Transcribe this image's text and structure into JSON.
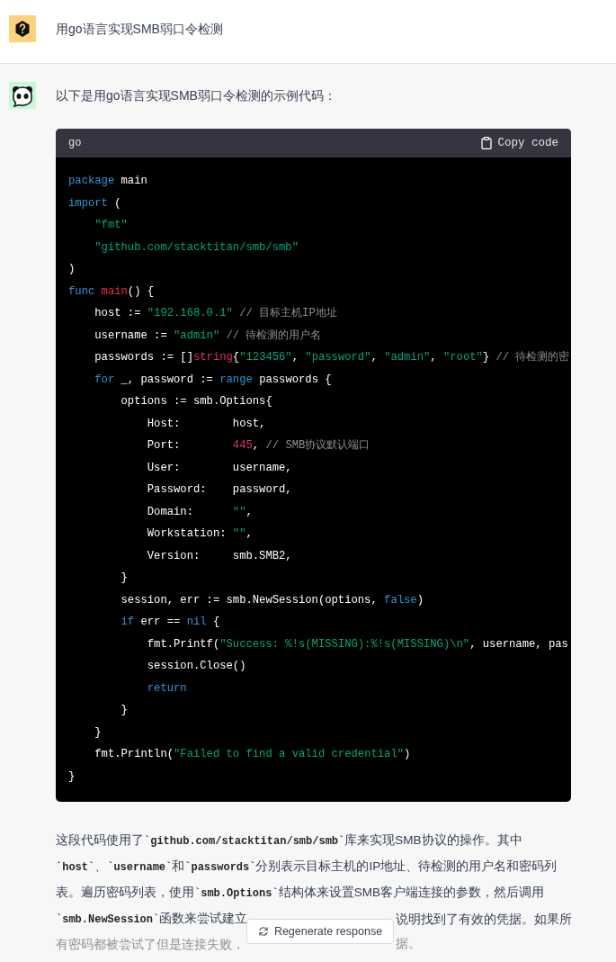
{
  "question": {
    "text": "用go语言实现SMB弱口令检测"
  },
  "answer": {
    "intro": "以下是用go语言实现SMB弱口令检测的示例代码：",
    "code_block": {
      "language": "go",
      "copy_label": "Copy code",
      "lines": [
        [
          {
            "kind": "kw",
            "text": "package"
          },
          {
            "kind": "plain",
            "text": " main"
          }
        ],
        [
          {
            "kind": "kw",
            "text": "import"
          },
          {
            "kind": "plain",
            "text": " ("
          }
        ],
        [
          {
            "kind": "str",
            "text": "    \"fmt\""
          }
        ],
        [
          {
            "kind": "str",
            "text": "    \"github.com/stacktitan/smb/smb\""
          }
        ],
        [
          {
            "kind": "plain",
            "text": ")"
          }
        ],
        [
          {
            "kind": "kw",
            "text": "func"
          },
          {
            "kind": "fn",
            "text": " main"
          },
          {
            "kind": "plain",
            "text": "() {"
          }
        ],
        [
          {
            "kind": "plain",
            "text": "    host := "
          },
          {
            "kind": "str",
            "text": "\"192.168.0.1\""
          },
          {
            "kind": "cm",
            "text": " // 目标主机IP地址"
          }
        ],
        [
          {
            "kind": "plain",
            "text": "    username := "
          },
          {
            "kind": "str",
            "text": "\"admin\""
          },
          {
            "kind": "cm",
            "text": " // 待检测的用户名"
          }
        ],
        [
          {
            "kind": "plain",
            "text": "    passwords := []"
          },
          {
            "kind": "type",
            "text": "string"
          },
          {
            "kind": "plain",
            "text": "{"
          },
          {
            "kind": "str",
            "text": "\"123456\""
          },
          {
            "kind": "plain",
            "text": ", "
          },
          {
            "kind": "str",
            "text": "\"password\""
          },
          {
            "kind": "plain",
            "text": ", "
          },
          {
            "kind": "str",
            "text": "\"admin\""
          },
          {
            "kind": "plain",
            "text": ", "
          },
          {
            "kind": "str",
            "text": "\"root\""
          },
          {
            "kind": "plain",
            "text": "} "
          },
          {
            "kind": "cm",
            "text": "// 待检测的密"
          }
        ],
        [
          {
            "kind": "kw",
            "text": "    for"
          },
          {
            "kind": "plain",
            "text": " _, password := "
          },
          {
            "kind": "kw",
            "text": "range"
          },
          {
            "kind": "plain",
            "text": " passwords {"
          }
        ],
        [
          {
            "kind": "plain",
            "text": "        options := smb.Options{"
          }
        ],
        [
          {
            "kind": "plain",
            "text": "            Host:        host,"
          }
        ],
        [
          {
            "kind": "plain",
            "text": "            Port:        "
          },
          {
            "kind": "num",
            "text": "445"
          },
          {
            "kind": "plain",
            "text": ", "
          },
          {
            "kind": "cm",
            "text": "// SMB协议默认端口"
          }
        ],
        [
          {
            "kind": "plain",
            "text": "            User:        username,"
          }
        ],
        [
          {
            "kind": "plain",
            "text": "            Password:    password,"
          }
        ],
        [
          {
            "kind": "plain",
            "text": "            Domain:      "
          },
          {
            "kind": "str",
            "text": "\"\""
          },
          {
            "kind": "plain",
            "text": ","
          }
        ],
        [
          {
            "kind": "plain",
            "text": "            Workstation: "
          },
          {
            "kind": "str",
            "text": "\"\""
          },
          {
            "kind": "plain",
            "text": ","
          }
        ],
        [
          {
            "kind": "plain",
            "text": "            Version:     smb.SMB2,"
          }
        ],
        [
          {
            "kind": "plain",
            "text": "        }"
          }
        ],
        [
          {
            "kind": "plain",
            "text": "        session, err := smb.NewSession(options, "
          },
          {
            "kind": "kw",
            "text": "false"
          },
          {
            "kind": "plain",
            "text": ")"
          }
        ],
        [
          {
            "kind": "kw",
            "text": "        if"
          },
          {
            "kind": "plain",
            "text": " err == "
          },
          {
            "kind": "kw",
            "text": "nil"
          },
          {
            "kind": "plain",
            "text": " {"
          }
        ],
        [
          {
            "kind": "plain",
            "text": "            fmt.Printf("
          },
          {
            "kind": "str",
            "text": "\"Success: %!s(MISSING):%!s(MISSING)\\n\""
          },
          {
            "kind": "plain",
            "text": ", username, pas"
          }
        ],
        [
          {
            "kind": "plain",
            "text": "            session.Close()"
          }
        ],
        [
          {
            "kind": "kw",
            "text": "            return"
          }
        ],
        [
          {
            "kind": "plain",
            "text": "        }"
          }
        ],
        [
          {
            "kind": "plain",
            "text": "    }"
          }
        ],
        [
          {
            "kind": "plain",
            "text": "    fmt.Println("
          },
          {
            "kind": "str",
            "text": "\"Failed to find a valid credential\""
          },
          {
            "kind": "plain",
            "text": ")"
          }
        ],
        [
          {
            "kind": "plain",
            "text": "}"
          }
        ]
      ]
    },
    "explanation": {
      "lines": [
        "这段代码使用了**`github.com/stacktitan/smb/smb`**库来实现SMB协议的操作。其中",
        "**`host`**、**`username`**和**`passwords`**分别表示目标主机的IP地址、待检测的用户名和密码列",
        "表。遍历密码列表，使用**`smb.Options`**结构体来设置SMB客户端连接的参数，然后调用"
      ],
      "covered_lines": [
        {
          "left": "**`smb.NewSession`**函数来尝试建立",
          "right": "说明找到了有效的凭据。如果所",
          "faded": false
        },
        {
          "left": "有密码都被尝试了但是连接失败，",
          "right": "据。",
          "faded": true
        }
      ]
    }
  },
  "regenerate_button": {
    "label": "Regenerate response"
  }
}
